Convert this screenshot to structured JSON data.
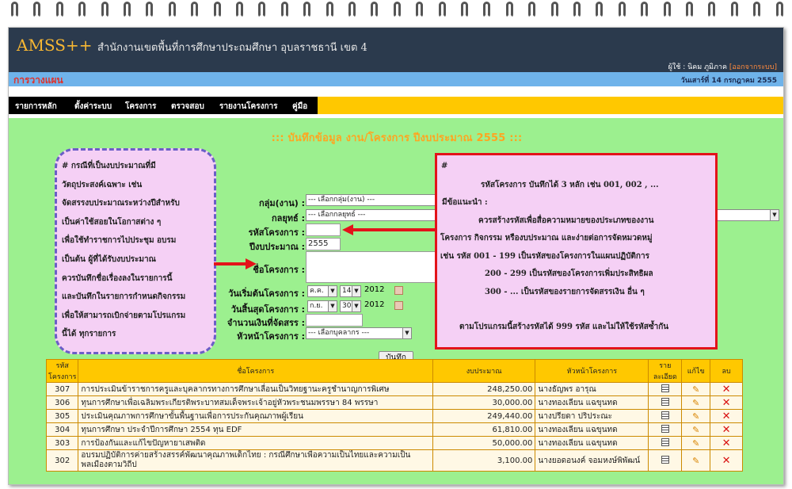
{
  "app": {
    "brand": "AMSS++",
    "agency": "สำนักงานเขตพื้นที่การศึกษาประถมศึกษา อุบลราชธานี เขต 4"
  },
  "user": {
    "prefix": "ผู้ใช้ : นิคม ภูมิภาค",
    "logout": "[ออกจากระบบ]"
  },
  "module": "การวางแผน",
  "date": "วันเสาร์ที่ 14 กรกฎาคม 2555",
  "menu": [
    "รายการหลัก",
    "ตั้งค่าระบบ",
    "โครงการ",
    "ตรวจสอบ",
    "รายงานโครงการ",
    "คู่มือ"
  ],
  "page_title": "::: บันทึกข้อมูล งาน/โครงการ ปีงบประมาณ 2555 :::",
  "note_lines": [
    "# กรณีที่เป็นงบประมาณที่มี",
    "วัตถุประสงค์เฉพาะ เช่น",
    "จัดสรรงบประมาณระหว่างปีสำหรับ",
    "เป็นค่าใช้สอยในโอกาสต่าง ๆ",
    "เพื่อใช้ทำราชการไปประชุม อบรม",
    "เป็นต้น ผู้ที่ได้รับงบประมาณ",
    "ควรบันทึกชื่อเรื่องลงในรายการนี้",
    "และบันทึกในรายการกำหนดกิจกรรม",
    "เพื่อให้สามารถเบิกจ่ายตามโปรแกรม",
    "นี้ได้ ทุกรายการ"
  ],
  "form": {
    "group_label": "กลุ่ม(งาน) :",
    "group_value": "--- เลือกกลุ่ม(งาน) ---",
    "strategy_label": "กลยุทธ์ :",
    "strategy_value": "--- เลือกกลยุทธ์ ---",
    "code_label": "รหัสโครงการ :",
    "code_value": "",
    "year_label": "ปีงบประมาณ :",
    "year_value": "2555",
    "name_label": "ชื่อโครงการ :",
    "name_value": "",
    "start_label": "วันเริ่มต้นโครงการ :",
    "start_month": "ค.ค.",
    "start_day": "14",
    "start_year": "2012",
    "end_label": "วันสิ้นสุดโครงการ :",
    "end_month": "ก.ย.",
    "end_day": "30",
    "end_year": "2012",
    "amount_label": "จำนวนเงินที่จัดสรร :",
    "amount_value": "",
    "head_label": "หัวหน้าโครงการ :",
    "head_value": "--- เลือกบุคลากร ---",
    "save": "บันทึก"
  },
  "tip": {
    "hash": "#",
    "line1": "รหัสโครงการ บันทึกได้ 3 หลัก เช่น 001, 002 , ...",
    "line2": "มีข้อแนะนำ :",
    "line3": "ควรสร้างรหัสเพื่อสื่อความหมายของประเภทของงาน",
    "line4": "โครงการ กิจกรรม หรืองบประมาณ และง่ายต่อการจัดหมวดหมู่",
    "line5": "เช่น รหัส 001 - 199 เป็นรหัสของโครงการในแผนปฏิบัติการ",
    "line6": "200 - 299 เป็นรหัสของโครงการเพิ่มประสิทธิผล",
    "line7": "300 - ... เป็นรหัสของรายการจัดสรรเงิน อื่น ๆ",
    "line8": "ตามโปรแกรมนี้สร้างรหัสได้ 999 รหัส และไม่ให้ใช้รหัสซ้ำกัน"
  },
  "table": {
    "headers": {
      "code": "รหัส โครงการ",
      "name": "ชื่อโครงการ",
      "budget": "งบประมาณ",
      "head": "หัวหน้าโครงการ",
      "detail": "ราย ละเอียด",
      "edit": "แก้ไข",
      "del": "ลบ"
    },
    "rows": [
      {
        "code": "307",
        "name": "การประเมินข้าราชการครูและบุคลากรทางการศึกษาเลื่อนเป็นวิทยฐานะครูชำนาญการพิเศษ",
        "budget": "248,250.00",
        "head": "นางธัญพร อารุณ"
      },
      {
        "code": "306",
        "name": "ทุนการศึกษาเพื่อเฉลิมพระเกียรติพระบาทสมเด็จพระเจ้าอยู่หัวพระชนมพรรษา 84 พรรษา",
        "budget": "30,000.00",
        "head": "นางทองเลียน แฉขุนทด"
      },
      {
        "code": "305",
        "name": "ประเมินคุณภาพการศึกษาขั้นพื้นฐานเพื่อการประกันคุณภาพผู้เรียน",
        "budget": "249,440.00",
        "head": "นางปรียดา ปริประณะ"
      },
      {
        "code": "304",
        "name": "ทุนการศึกษา ประจำปีการศึกษา 2554 ทุน EDF",
        "budget": "61,810.00",
        "head": "นางทองเลียน แฉขุนทด"
      },
      {
        "code": "303",
        "name": "การป้องกันและแก้ไขปัญหายาเสพติด",
        "budget": "50,000.00",
        "head": "นางทองเลียน แฉขุนทด"
      },
      {
        "code": "302",
        "name": "อบรมปฏิบัติการค่ายสร้างสรรค์พัฒนาคุณภาพเด็กไทย : กรณีศึกษาเพื่อความเป็นไทยและความเป็นพลเมืองตามวิถีป",
        "budget": "3,100.00",
        "head": "นางยอดอนงค์ จอมหงษ์พิพัฒน์"
      }
    ]
  },
  "colors": {
    "topbar": "#2b3a4d",
    "brand": "#f7b733",
    "content": "#9cf08f",
    "menubar": "#ffc800",
    "redbox": "#e3131a",
    "arrow": "#e3131a"
  }
}
